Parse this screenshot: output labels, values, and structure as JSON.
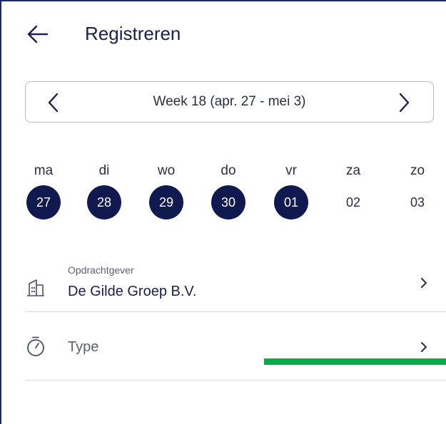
{
  "header": {
    "title": "Registreren"
  },
  "week": {
    "label": "Week 18 (apr. 27 - mei 3)"
  },
  "days": [
    {
      "name": "ma",
      "num": "27",
      "selected": true
    },
    {
      "name": "di",
      "num": "28",
      "selected": true
    },
    {
      "name": "wo",
      "num": "29",
      "selected": true
    },
    {
      "name": "do",
      "num": "30",
      "selected": true
    },
    {
      "name": "vr",
      "num": "01",
      "selected": true
    },
    {
      "name": "za",
      "num": "02",
      "selected": false
    },
    {
      "name": "zo",
      "num": "03",
      "selected": false
    }
  ],
  "client": {
    "caption": "Opdrachtgever",
    "value": "De Gilde Groep B.V."
  },
  "type": {
    "placeholder": "Type"
  },
  "colors": {
    "primary": "#101a4f",
    "progress": "#0aaa4a",
    "border": "#b8bac4"
  }
}
